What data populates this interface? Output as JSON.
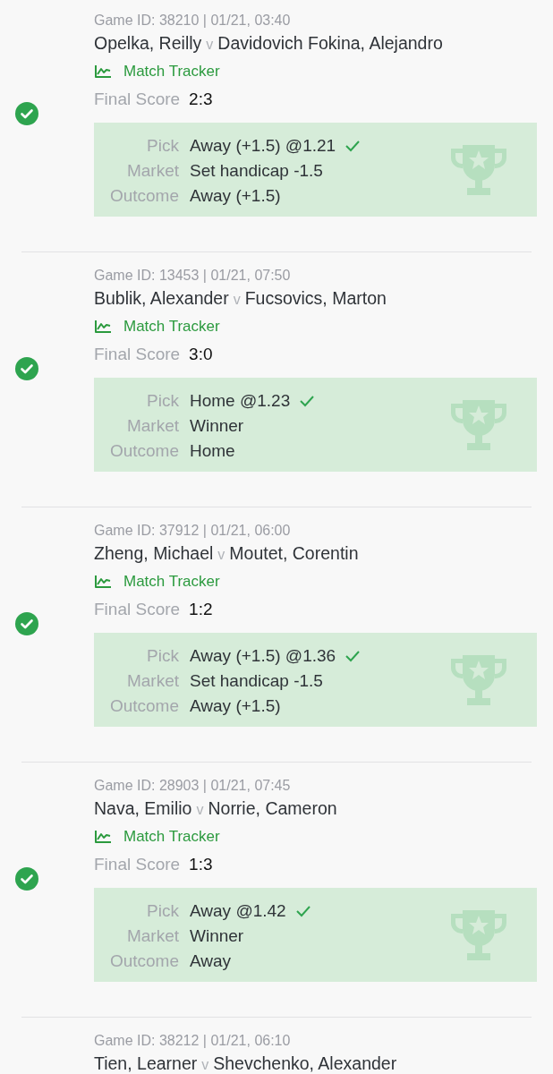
{
  "games": [
    {
      "game_line": "Game ID: 38210 | 01/21, 03:40",
      "home": "Opelka, Reilly",
      "versus": "v",
      "away": "Davidovich Fokina, Alejandro",
      "tracker": "Match Tracker",
      "score_label": "Final Score",
      "score": "2:3",
      "won": true,
      "bet": [
        {
          "label": "Pick",
          "value": "Away (+1.5) @1.21",
          "ticked": true
        },
        {
          "label": "Market",
          "value": "Set handicap -1.5",
          "ticked": false
        },
        {
          "label": "Outcome",
          "value": "Away (+1.5)",
          "ticked": false
        }
      ]
    },
    {
      "game_line": "Game ID: 13453 | 01/21, 07:50",
      "home": "Bublik, Alexander",
      "versus": "v",
      "away": "Fucsovics, Marton",
      "tracker": "Match Tracker",
      "score_label": "Final Score",
      "score": "3:0",
      "won": true,
      "bet": [
        {
          "label": "Pick",
          "value": "Home @1.23",
          "ticked": true
        },
        {
          "label": "Market",
          "value": "Winner",
          "ticked": false
        },
        {
          "label": "Outcome",
          "value": "Home",
          "ticked": false
        }
      ]
    },
    {
      "game_line": "Game ID: 37912 | 01/21, 06:00",
      "home": "Zheng, Michael",
      "versus": "v",
      "away": "Moutet, Corentin",
      "tracker": "Match Tracker",
      "score_label": "Final Score",
      "score": "1:2",
      "won": true,
      "bet": [
        {
          "label": "Pick",
          "value": "Away (+1.5) @1.36",
          "ticked": true
        },
        {
          "label": "Market",
          "value": "Set handicap -1.5",
          "ticked": false
        },
        {
          "label": "Outcome",
          "value": "Away (+1.5)",
          "ticked": false
        }
      ]
    },
    {
      "game_line": "Game ID: 28903 | 01/21, 07:45",
      "home": "Nava, Emilio",
      "versus": "v",
      "away": "Norrie, Cameron",
      "tracker": "Match Tracker",
      "score_label": "Final Score",
      "score": "1:3",
      "won": true,
      "bet": [
        {
          "label": "Pick",
          "value": "Away @1.42",
          "ticked": true
        },
        {
          "label": "Market",
          "value": "Winner",
          "ticked": false
        },
        {
          "label": "Outcome",
          "value": "Away",
          "ticked": false
        }
      ]
    },
    {
      "game_line": "Game ID: 38212 | 01/21, 06:10",
      "home": "Tien, Learner",
      "versus": "v",
      "away": "Shevchenko, Alexander"
    }
  ]
}
